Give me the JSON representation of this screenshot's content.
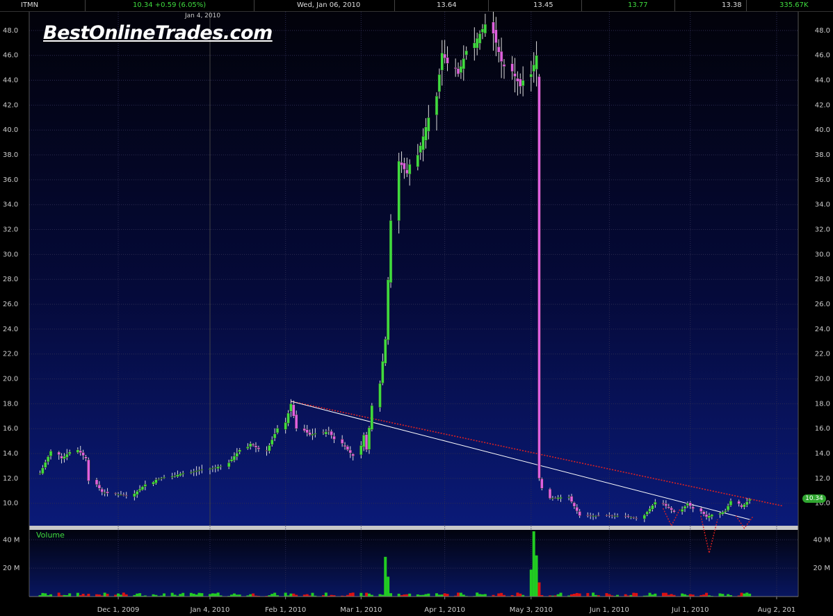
{
  "header": {
    "symbol": "ITMN",
    "last_change": "10.34 +0.59 (6.05%)",
    "date": "Wed, Jan 06, 2010",
    "open": "13.64",
    "low_val": "13.45",
    "high_val": "13.77",
    "close_val": "13.38",
    "volume": "335.67K"
  },
  "watermark": "BestOnlineTrades.com",
  "crosshair_date": "Jan 4, 2010",
  "current_price_tag": "10.34",
  "colors": {
    "up": "#3fdc3f",
    "down": "#e060e0",
    "vol_up": "#22cc22",
    "vol_down": "#dd1111",
    "trend": "#dd2222"
  },
  "chart_data": {
    "type": "candlestick",
    "symbol": "ITMN",
    "price_axis": {
      "ylim": [
        8.2,
        49.5
      ],
      "ticks": [
        "10.0",
        "12.0",
        "14.0",
        "16.0",
        "18.0",
        "20.0",
        "22.0",
        "24.0",
        "26.0",
        "28.0",
        "30.0",
        "32.0",
        "34.0",
        "36.0",
        "38.0",
        "40.0",
        "42.0",
        "44.0",
        "46.0",
        "48.0"
      ]
    },
    "volume_axis": {
      "label": "Volume",
      "ylim": [
        0,
        47
      ],
      "ticks": [
        "20 M",
        "40 M"
      ]
    },
    "x_axis_labels": [
      "Dec 1, 2009",
      "Jan 4, 2010",
      "Feb 1, 2010",
      "Mar 1, 2010",
      "Apr 1, 2010",
      "May 3, 2010",
      "Jun 1, 2010",
      "Jul 1, 2010",
      "Aug 2, 201"
    ],
    "ohlc_anchors": [
      {
        "date": "2009-11-02",
        "close": 12.4
      },
      {
        "date": "2009-11-06",
        "close": 14.2
      },
      {
        "date": "2009-11-10",
        "close": 13.6
      },
      {
        "date": "2009-11-16",
        "close": 14.3
      },
      {
        "date": "2009-11-19",
        "close": 13.6
      },
      {
        "date": "2009-11-20",
        "close": 11.8
      },
      {
        "date": "2009-11-25",
        "close": 10.9
      },
      {
        "date": "2009-12-04",
        "close": 10.6
      },
      {
        "date": "2009-12-15",
        "close": 11.9
      },
      {
        "date": "2009-12-28",
        "close": 12.5
      },
      {
        "date": "2010-01-08",
        "close": 13.0
      },
      {
        "date": "2010-01-13",
        "close": 13.8
      },
      {
        "date": "2010-01-19",
        "close": 14.8
      },
      {
        "date": "2010-01-25",
        "close": 14.2
      },
      {
        "date": "2010-02-01",
        "close": 16.5
      },
      {
        "date": "2010-02-03",
        "close": 18.0
      },
      {
        "date": "2010-02-05",
        "close": 16.0
      },
      {
        "date": "2010-02-10",
        "close": 15.5
      },
      {
        "date": "2010-02-17",
        "close": 15.8
      },
      {
        "date": "2010-02-22",
        "close": 14.8
      },
      {
        "date": "2010-02-26",
        "close": 13.8
      },
      {
        "date": "2010-03-02",
        "close": 15.5
      },
      {
        "date": "2010-03-03",
        "close": 14.3
      },
      {
        "date": "2010-03-10",
        "close": 23.2
      },
      {
        "date": "2010-03-15",
        "close": 37.5
      },
      {
        "date": "2010-03-18",
        "close": 36.5
      },
      {
        "date": "2010-03-26",
        "close": 41.0
      },
      {
        "date": "2010-03-31",
        "close": 46.2
      },
      {
        "date": "2010-04-06",
        "close": 44.5
      },
      {
        "date": "2010-04-12",
        "close": 47.0
      },
      {
        "date": "2010-04-16",
        "close": 48.5
      },
      {
        "date": "2010-04-22",
        "close": 45.5
      },
      {
        "date": "2010-04-29",
        "close": 43.5
      },
      {
        "date": "2010-05-03",
        "close": 44.5
      },
      {
        "date": "2010-05-05",
        "close": 46.0
      },
      {
        "date": "2010-05-06",
        "close": 12.0
      },
      {
        "date": "2010-05-10",
        "close": 10.4
      },
      {
        "date": "2010-05-17",
        "close": 10.5
      },
      {
        "date": "2010-05-21",
        "close": 9.0
      },
      {
        "date": "2010-06-04",
        "close": 9.0
      },
      {
        "date": "2010-06-11",
        "close": 8.8
      },
      {
        "date": "2010-06-18",
        "close": 10.1
      },
      {
        "date": "2010-06-25",
        "close": 9.3
      },
      {
        "date": "2010-06-30",
        "close": 10.0
      },
      {
        "date": "2010-07-07",
        "close": 8.9
      },
      {
        "date": "2010-07-14",
        "close": 9.4
      },
      {
        "date": "2010-07-16",
        "close": 10.2
      },
      {
        "date": "2010-07-20",
        "close": 9.7
      },
      {
        "date": "2010-07-23",
        "close": 10.34
      }
    ],
    "volume_spikes_M": [
      {
        "date": "2010-03-10",
        "volume": 28
      },
      {
        "date": "2010-03-11",
        "volume": 14
      },
      {
        "date": "2010-05-03",
        "volume": 19
      },
      {
        "date": "2010-05-04",
        "volume": 46
      },
      {
        "date": "2010-05-05",
        "volume": 29
      },
      {
        "date": "2010-05-06",
        "volume": 10
      }
    ],
    "trendlines": [
      {
        "style": "dotted-red",
        "from": {
          "date": "2010-02-03",
          "price": 18.2
        },
        "to": {
          "date": "2010-08-04",
          "price": 9.8
        }
      },
      {
        "style": "solid-white",
        "from": {
          "date": "2010-02-03",
          "price": 18.2
        },
        "to": {
          "date": "2010-07-23",
          "price": 8.7
        }
      }
    ],
    "neckline_vees": [
      {
        "date": "2010-06-24",
        "low_price": 8.2
      },
      {
        "date": "2010-07-08",
        "low_price": 6.0
      },
      {
        "date": "2010-07-21",
        "low_price": 8.0
      }
    ]
  }
}
